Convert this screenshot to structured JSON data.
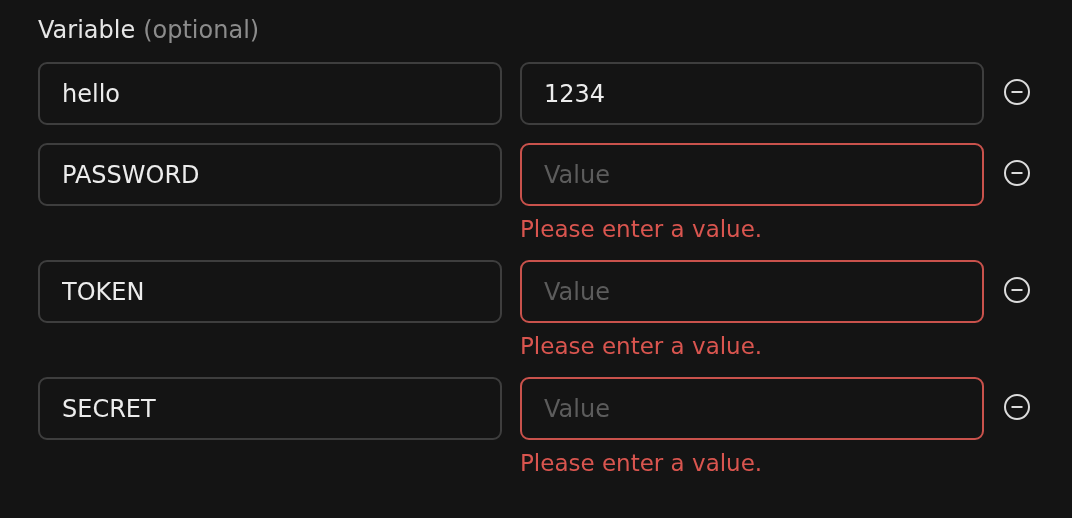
{
  "field_label": {
    "text": "Variable",
    "hint": "(optional)"
  },
  "rows": [
    {
      "key": "hello",
      "value": "1234",
      "invalid": false
    },
    {
      "key": "PASSWORD",
      "placeholder": "Value",
      "invalid": true,
      "error": "Please enter a value."
    },
    {
      "key": "TOKEN",
      "placeholder": "Value",
      "invalid": true,
      "error": "Please enter a value."
    },
    {
      "key": "SECRET",
      "placeholder": "Value",
      "invalid": true,
      "error": "Please enter a value."
    }
  ]
}
